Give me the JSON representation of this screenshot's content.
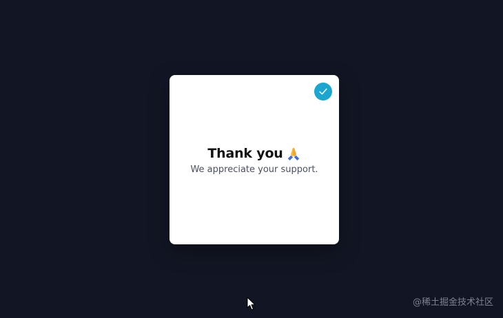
{
  "dialog": {
    "title": "Thank you",
    "message": "We appreciate your support.",
    "title_icon": "folded-hands-icon",
    "badge_icon": "check-icon"
  },
  "watermark": {
    "text": "@稀土掘金技术社区"
  },
  "colors": {
    "background": "#121624",
    "card": "#ffffff",
    "accent": "#1aa6d1",
    "title": "#111111",
    "message": "#4b5060"
  }
}
